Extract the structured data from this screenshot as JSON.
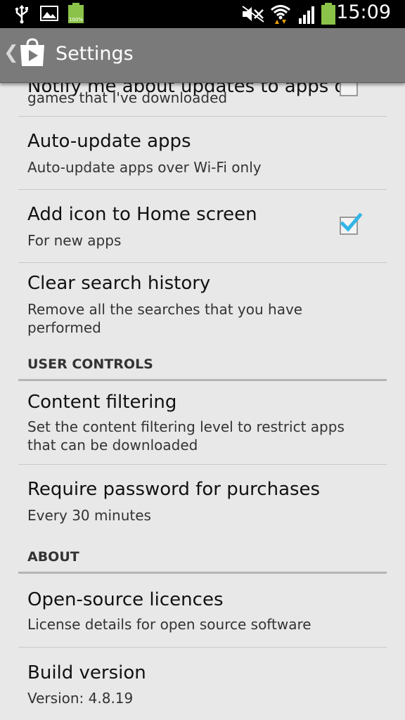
{
  "status_bar": {
    "time": "15:09",
    "battery_label": "100%",
    "icons": [
      "usb-icon",
      "image-icon",
      "battery-icon",
      "mute-icon",
      "wifi-icon",
      "signal-icon",
      "battery-icon"
    ]
  },
  "action_bar": {
    "title": "Settings",
    "icon": "play-store-icon"
  },
  "settings": {
    "notify": {
      "title": "Notify me about updates to apps or",
      "summary": "games that I've downloaded",
      "checked": false
    },
    "auto_update": {
      "title": "Auto-update apps",
      "summary": "Auto-update apps over Wi-Fi only"
    },
    "add_icon": {
      "title": "Add icon to Home screen",
      "summary": "For new apps",
      "checked": true
    },
    "clear_history": {
      "title": "Clear search history",
      "summary": "Remove all the searches that you have performed"
    },
    "user_controls_header": "USER CONTROLS",
    "content_filtering": {
      "title": "Content filtering",
      "summary": "Set the content filtering level to restrict apps that can be downloaded"
    },
    "require_password": {
      "title": "Require password for purchases",
      "summary": "Every 30 minutes"
    },
    "about_header": "ABOUT",
    "open_source": {
      "title": "Open-source licences",
      "summary": "License details for open source software"
    },
    "build_version": {
      "title": "Build version",
      "summary": "Version: 4.8.19"
    }
  },
  "colors": {
    "background": "#e8e8e8",
    "action_bar": "#7a7a7a",
    "check_accent": "#33b5e5",
    "battery_green": "#8bc34a"
  }
}
